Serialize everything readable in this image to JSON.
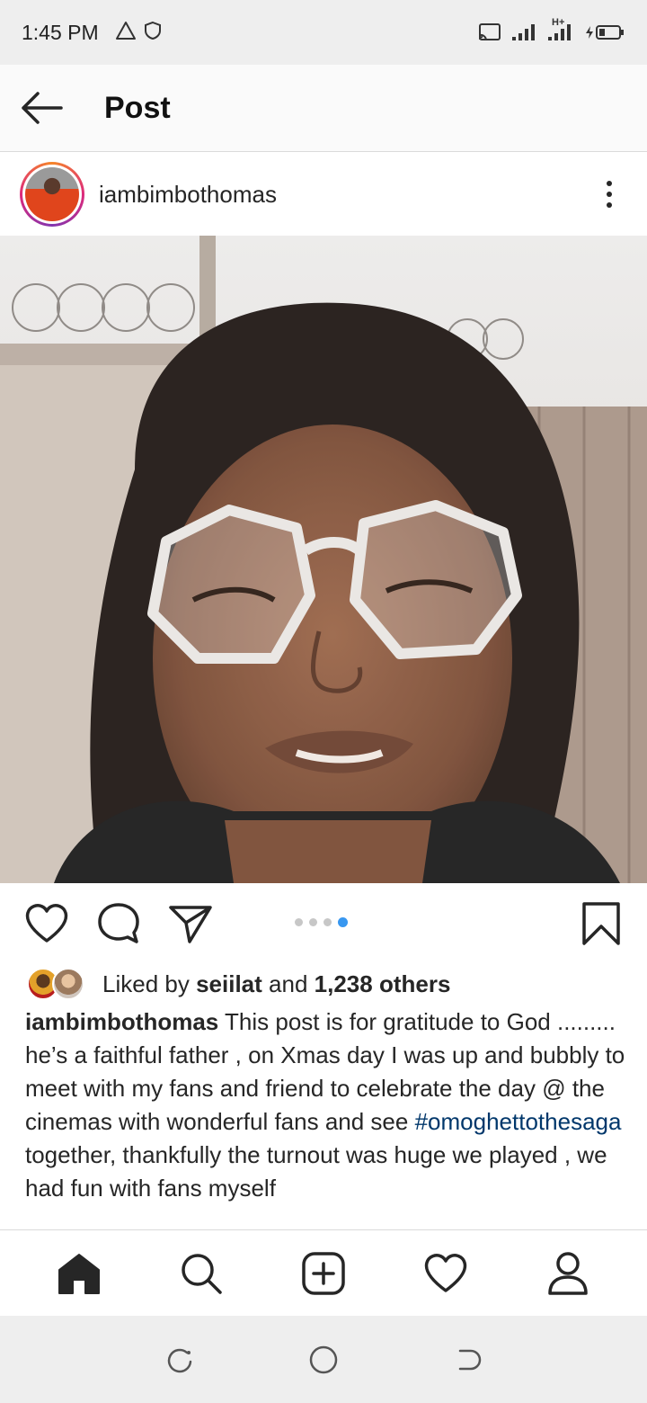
{
  "status_bar": {
    "time": "1:45 PM",
    "left_icons": [
      "warning-icon",
      "shield-icon"
    ],
    "right_icons": [
      "cast-icon",
      "signal-icon",
      "signal-h-plus-icon",
      "battery-charging-icon"
    ],
    "network_label": "H+"
  },
  "header": {
    "title": "Post"
  },
  "post": {
    "username": "iambimbothomas",
    "carousel": {
      "count": 4,
      "active_index": 3
    },
    "likes": {
      "prefix": "Liked by",
      "user": "seiilat",
      "and": "and",
      "count_text": "1,238 others"
    },
    "caption": {
      "user": "iambimbothomas",
      "text_1": "This post is for gratitude to God .........",
      "text_2": "he’s a faithful father , on Xmas day I was up and bubbly to meet with my fans and friend to celebrate the day @ the cinemas with wonderful fans and see",
      "hashtag": "#omoghettothesaga",
      "text_3": "together, thankfully the turnout was huge we played , we had fun with fans myself"
    }
  },
  "bottom_nav": [
    "home-icon",
    "search-icon",
    "add-post-icon",
    "activity-heart-icon",
    "profile-icon"
  ],
  "colors": {
    "accent_blue": "#3897f0",
    "hashtag": "#00376b",
    "text": "#262626"
  }
}
